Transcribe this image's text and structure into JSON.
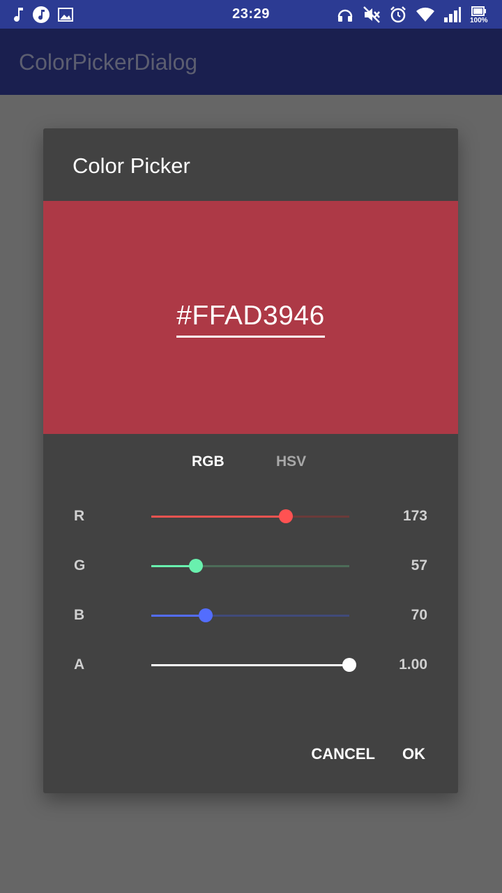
{
  "status_bar": {
    "time": "23:29",
    "battery": "100%",
    "icons_left": [
      "music-note-icon",
      "music-app-icon",
      "gallery-icon"
    ],
    "icons_right": [
      "headset-icon",
      "mute-icon",
      "alarm-icon",
      "wifi-icon",
      "signal-icon",
      "battery-icon"
    ],
    "color": "#2c3b93"
  },
  "app_bar": {
    "title": "ColorPickerDialog",
    "color": "#1a1f4f"
  },
  "dialog": {
    "title": "Color Picker",
    "preview_color": "#AD3946",
    "hex_value": "#FFAD3946",
    "tabs": [
      {
        "label": "RGB",
        "active": true
      },
      {
        "label": "HSV",
        "active": false
      }
    ],
    "sliders": [
      {
        "label": "R",
        "value": "173",
        "fraction": 0.678,
        "fill_color": "#ef5350",
        "rest_color": "#6b3a39",
        "thumb_color": "#ff5252"
      },
      {
        "label": "G",
        "value": "57",
        "fraction": 0.224,
        "fill_color": "#69f0ae",
        "rest_color": "#4c6c58",
        "thumb_color": "#69f0ae"
      },
      {
        "label": "B",
        "value": "70",
        "fraction": 0.275,
        "fill_color": "#536dfe",
        "rest_color": "#404a7a",
        "thumb_color": "#536dfe"
      },
      {
        "label": "A",
        "value": "1.00",
        "fraction": 1.0,
        "fill_color": "#ffffff",
        "rest_color": "#777777",
        "thumb_color": "#ffffff"
      }
    ],
    "cancel_label": "CANCEL",
    "ok_label": "OK"
  }
}
